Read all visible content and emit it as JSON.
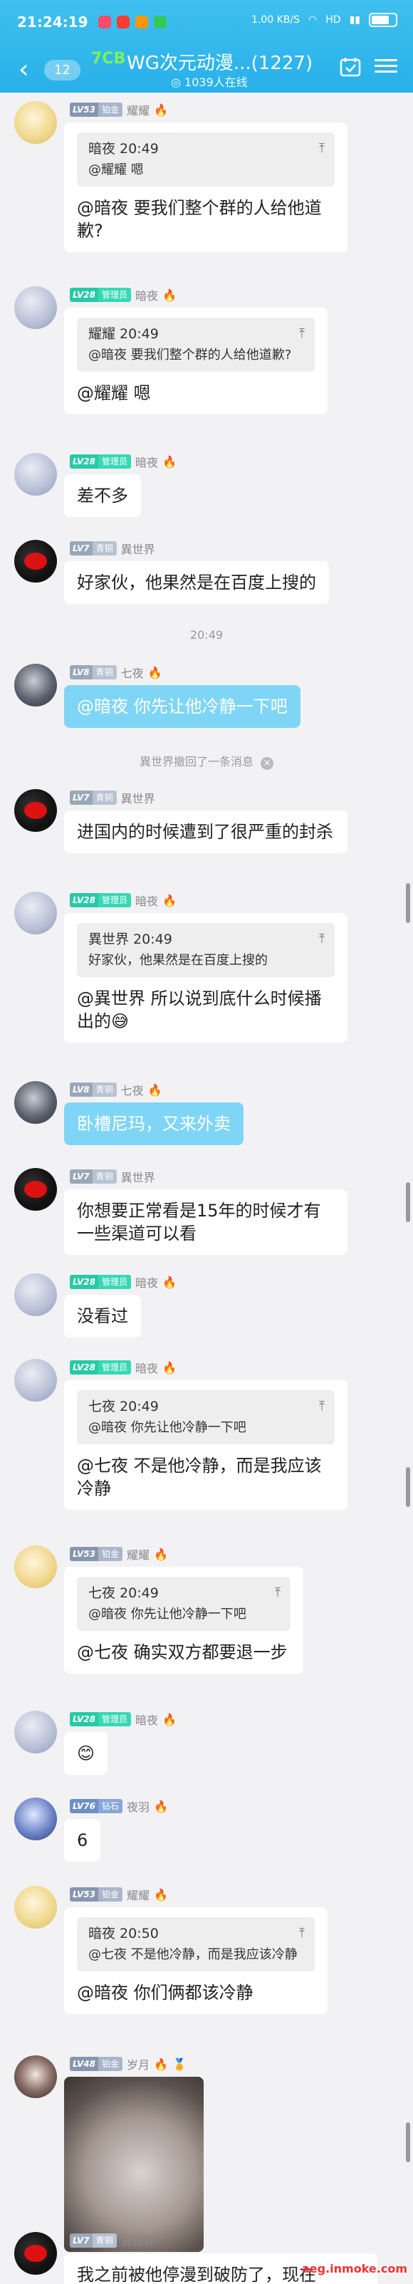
{
  "status_bar": {
    "time": "21:24:19",
    "net_speed": "1.00 KB/S",
    "carrier": "HD"
  },
  "header": {
    "unread": "12",
    "tag": "7CB",
    "title": "WG次元动漫...(1227)",
    "online": "1039人在线"
  },
  "messages": [
    {
      "level": "LV53",
      "title": "铂金",
      "name": "耀耀",
      "quote_head": "暗夜 20:49",
      "quote_text": "@耀耀 嗯",
      "text": "@暗夜 要我们整个群的人给他道歉?"
    },
    {
      "level": "LV28",
      "title": "管理员",
      "name": "暗夜",
      "quote_head": "耀耀 20:49",
      "quote_text": "@暗夜 要我们整个群的人给他道歉?",
      "text": "@耀耀 嗯"
    },
    {
      "level": "LV28",
      "title": "管理员",
      "name": "暗夜",
      "text": "差不多"
    },
    {
      "level": "LV7",
      "title": "青铜",
      "name": "異世界",
      "text": "好家伙，他果然是在百度上搜的"
    },
    {
      "level": "LV8",
      "title": "青铜",
      "name": "七夜",
      "text": "@暗夜 你先让他冷静一下吧"
    },
    {
      "level": "LV7",
      "title": "青铜",
      "name": "異世界",
      "text": "进国内的时候遭到了很严重的封杀"
    },
    {
      "level": "LV28",
      "title": "管理员",
      "name": "暗夜",
      "quote_head": "異世界 20:49",
      "quote_text": "好家伙，他果然是在百度上搜的",
      "text": "@異世界 所以说到底什么时候播出的😅"
    },
    {
      "level": "LV8",
      "title": "青铜",
      "name": "七夜",
      "text": "卧槽尼玛，又来外卖"
    },
    {
      "level": "LV7",
      "title": "青铜",
      "name": "異世界",
      "text": " 你想要正常看是15年的时候才有一些渠道可以看"
    },
    {
      "level": "LV28",
      "title": "管理员",
      "name": "暗夜",
      "text": "没看过"
    },
    {
      "level": "LV28",
      "title": "管理员",
      "name": "暗夜",
      "quote_head": "七夜 20:49",
      "quote_text": "@暗夜 你先让他冷静一下吧",
      "text": "@七夜 不是他冷静，而是我应该冷静"
    },
    {
      "level": "LV53",
      "title": "铂金",
      "name": "耀耀",
      "quote_head": "七夜 20:49",
      "quote_text": "@暗夜 你先让他冷静一下吧",
      "text": "@七夜 确实双方都要退一步"
    },
    {
      "level": "LV28",
      "title": "管理员",
      "name": "暗夜",
      "text": "😊"
    },
    {
      "level": "LV76",
      "title": "钻石",
      "name": "夜羽",
      "text": "6"
    },
    {
      "level": "LV53",
      "title": "铂金",
      "name": "耀耀",
      "quote_head": "暗夜 20:50",
      "quote_text": "@七夜 不是他冷静，而是我应该冷静",
      "text": "@暗夜 你们俩都该冷静"
    },
    {
      "level": "LV48",
      "title": "铂金",
      "name": "岁月",
      "image": "cat-photo"
    },
    {
      "level": "LV7",
      "title": "青铜",
      "name": "異世界",
      "text": "我之前被他停漫到破防了，现在"
    }
  ],
  "system": {
    "time": "20:49",
    "recall": "異世界撤回了一条消息"
  },
  "watermark": "aeg.inmoke.com"
}
